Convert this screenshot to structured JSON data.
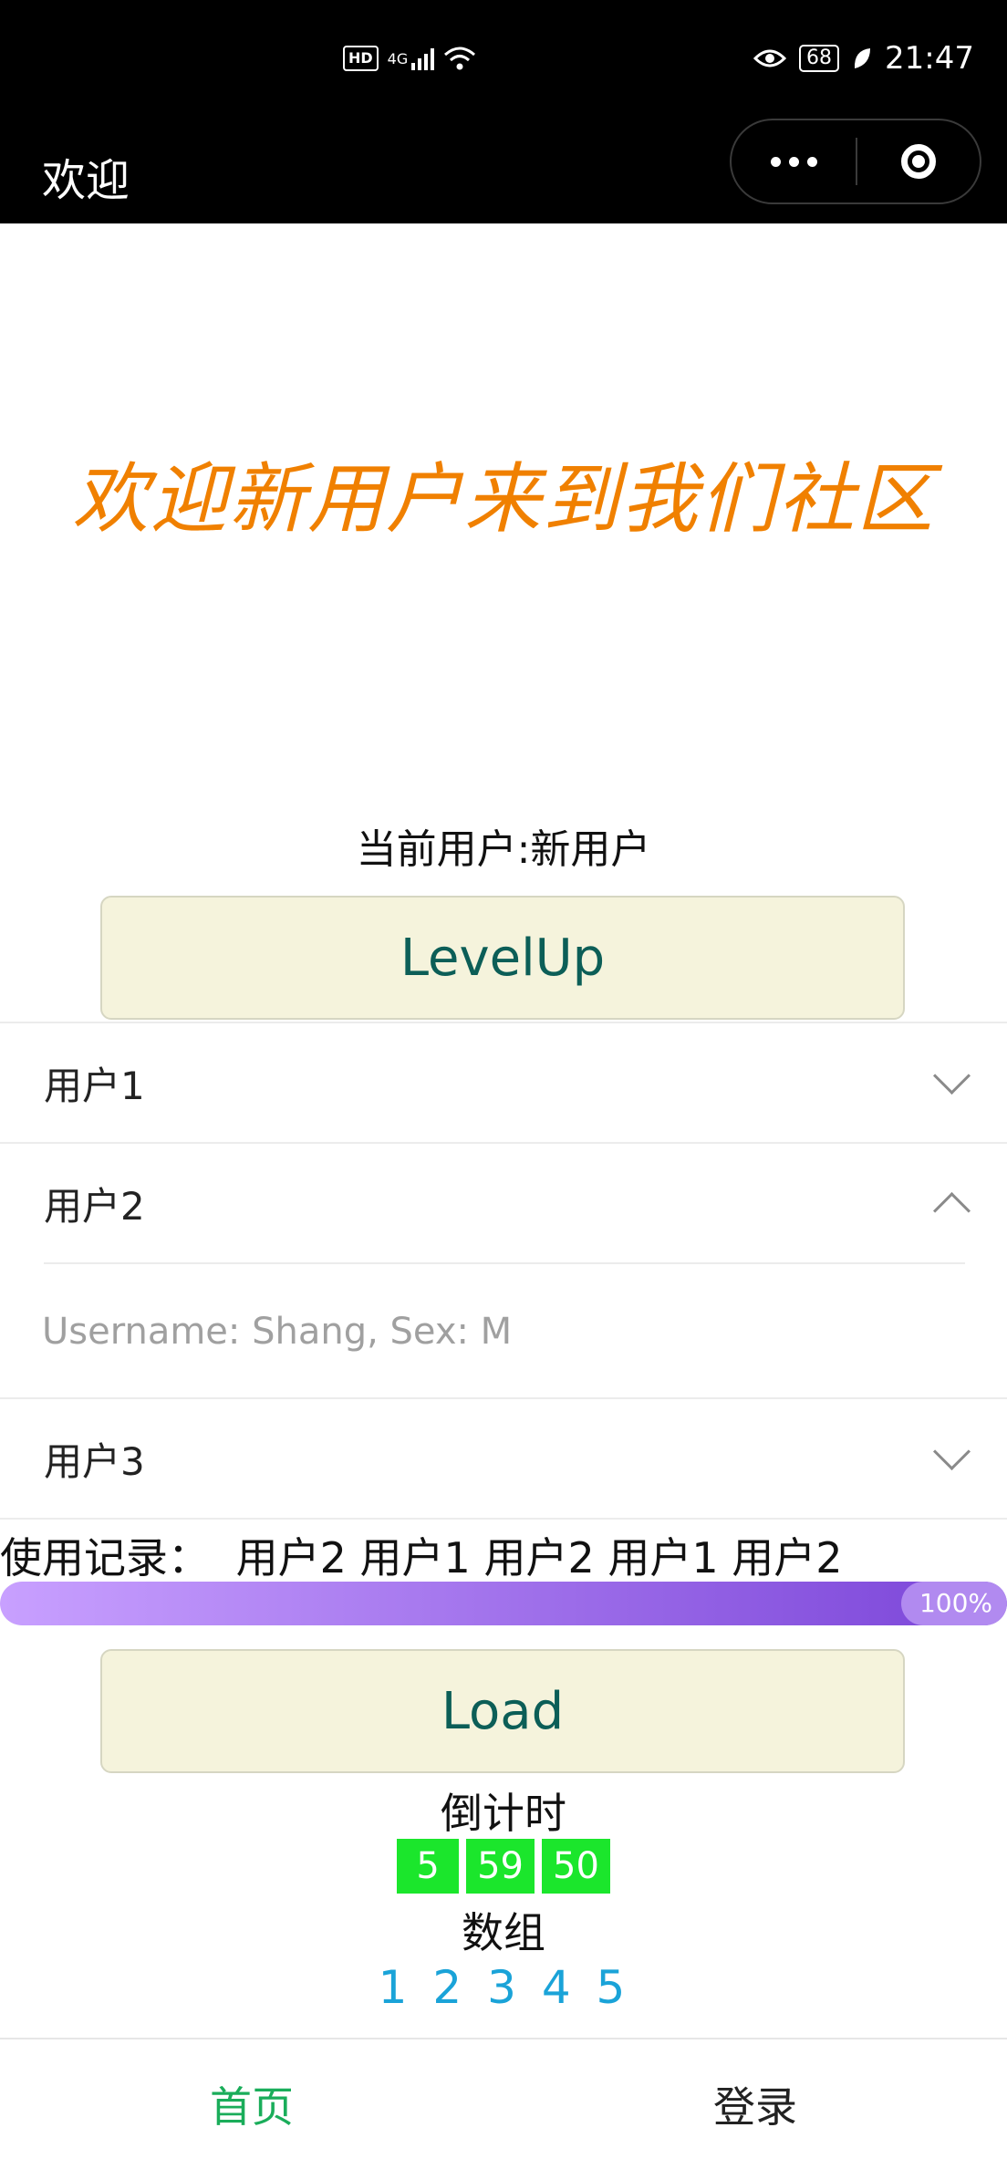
{
  "status_bar": {
    "network": "4G",
    "hd": "HD",
    "battery": "68",
    "time": "21:47",
    "icons": [
      "hd-icon",
      "signal-icon",
      "wifi-icon",
      "eye-icon",
      "battery-icon",
      "leaf-icon"
    ]
  },
  "nav": {
    "title": "欢迎"
  },
  "welcome_text": "欢迎新用户来到我们社区",
  "current_user": "当前用户:新用户",
  "buttons": {
    "levelup": "LevelUp",
    "load": "Load"
  },
  "users": [
    {
      "label": "用户1",
      "expanded": false
    },
    {
      "label": "用户2",
      "expanded": true,
      "content": "Username: Shang, Sex: M"
    },
    {
      "label": "用户3",
      "expanded": false
    }
  ],
  "history": {
    "label": "使用记录：",
    "items": [
      "用户2",
      "用户1",
      "用户2",
      "用户1",
      "用户2"
    ]
  },
  "progress": {
    "value": 1.0,
    "text": "100%"
  },
  "countdown": {
    "label": "倒计时",
    "values": [
      "5",
      "59",
      "50"
    ]
  },
  "array": {
    "label": "数组",
    "values": [
      "1",
      "2",
      "3",
      "4",
      "5"
    ]
  },
  "tabs": [
    {
      "label": "首页",
      "active": true
    },
    {
      "label": "登录",
      "active": false
    }
  ],
  "colors": {
    "accent_green": "#1aad5a",
    "welcome_orange": "#f08000",
    "countdown_green": "#1be62c",
    "array_blue": "#1aa3d8",
    "button_bg": "#f5f3dc",
    "button_text": "#0c5e57"
  }
}
